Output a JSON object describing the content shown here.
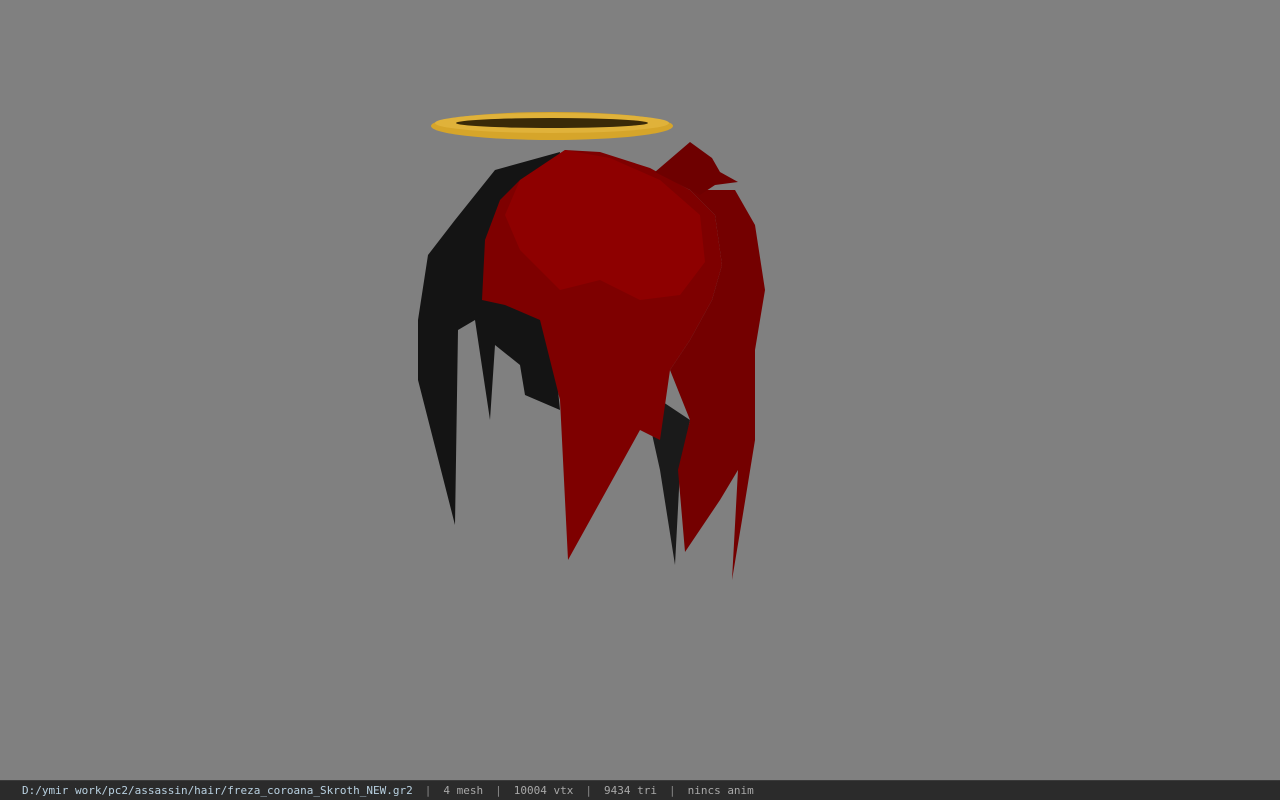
{
  "viewport": {
    "background": "#808080",
    "model": {
      "hair_colors": {
        "red": "#7a0000",
        "red_highlight": "#8e0000",
        "dark": "#141414"
      },
      "halo_color": "#d9a830"
    }
  },
  "status_bar": {
    "file_path": "D:/ymir work/pc2/assassin/hair/freza_coroana_Skroth_NEW.gr2",
    "separator": "|",
    "mesh_count": "4 mesh",
    "vertex_count": "10004 vtx",
    "triangle_count": "9434 tri",
    "animation": "nincs anim"
  }
}
